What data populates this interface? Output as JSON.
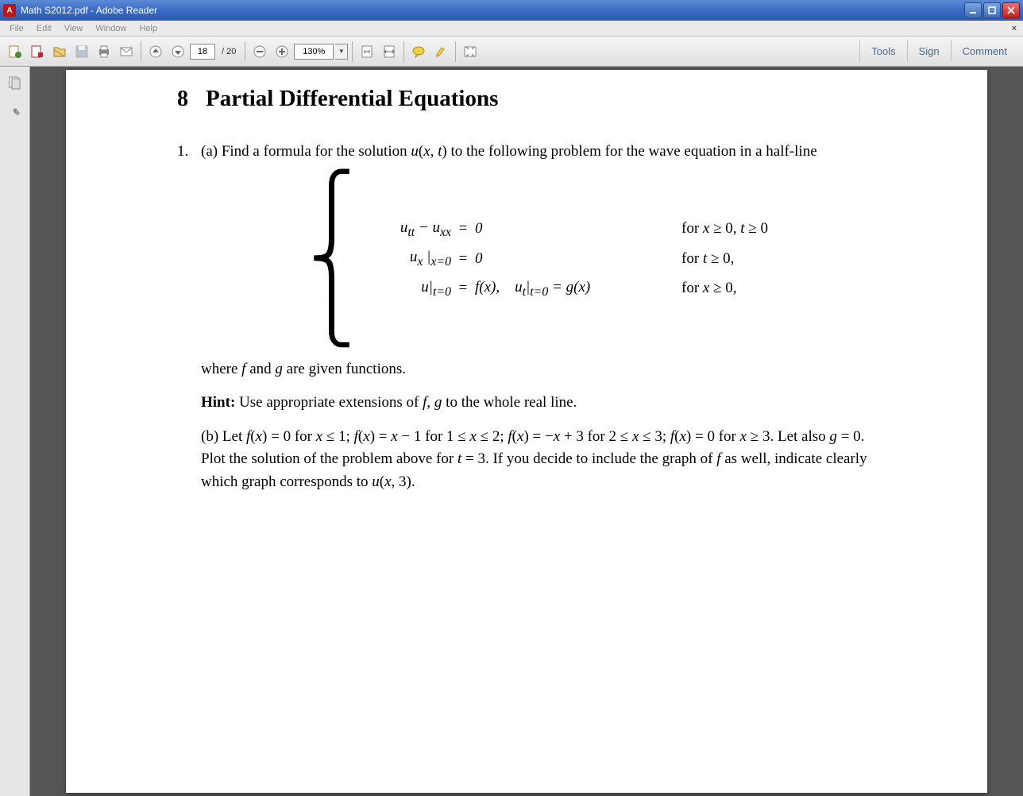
{
  "window": {
    "title": "Math S2012.pdf - Adobe Reader",
    "app_icon_text": "A"
  },
  "menu": {
    "items": [
      "File",
      "Edit",
      "View",
      "Window",
      "Help"
    ],
    "close_doc": "×"
  },
  "toolbar": {
    "page_current": "18",
    "page_total": "/ 20",
    "zoom": "130%",
    "right": {
      "tools": "Tools",
      "sign": "Sign",
      "comment": "Comment"
    }
  },
  "document": {
    "section_num": "8",
    "section_title": "Partial Differential Equations",
    "q1_num": "1.",
    "q1a_intro": "(a) Find a formula for the solution u(x, t) to the following problem for the wave equation in a half-line",
    "sys": [
      {
        "lhs": "u_{tt} − u_{xx}",
        "eq": "=",
        "rhs": "0",
        "cond": "for x ≥ 0, t ≥ 0"
      },
      {
        "lhs": "u_x |_{x=0}",
        "eq": "=",
        "rhs": "0",
        "cond": "for t ≥ 0,"
      },
      {
        "lhs": "u|_{t=0}",
        "eq": "=",
        "rhs": "f(x),   u_t|_{t=0} = g(x)",
        "cond": "for x ≥ 0,"
      }
    ],
    "where": "where f and g are given functions.",
    "hint_label": "Hint:",
    "hint_text": " Use appropriate extensions of f, g to the whole real line.",
    "q1b": "(b) Let f(x) = 0 for x ≤ 1; f(x) = x − 1 for 1 ≤ x ≤ 2; f(x) = −x + 3 for 2 ≤ x ≤ 3; f(x) = 0 for x ≥ 3. Let also g = 0. Plot the solution of the problem above for t = 3. If you decide to include the graph of f as well, indicate clearly which graph corresponds to u(x, 3)."
  }
}
